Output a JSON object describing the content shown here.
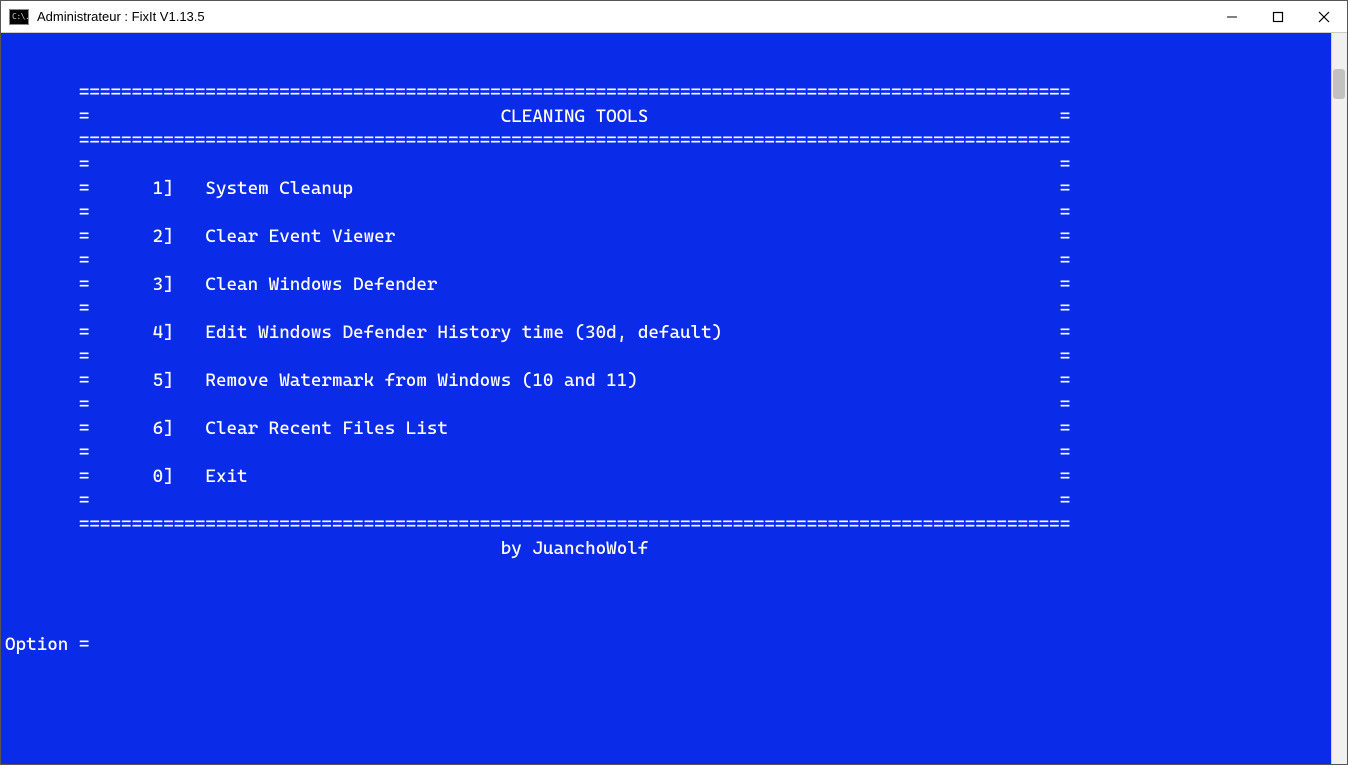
{
  "window": {
    "title": "Administrateur :  FixIt V1.13.5",
    "icon_text": "C:\\."
  },
  "console": {
    "hr": "==============================================================================================",
    "title": "CLEANING TOOLS",
    "menu": [
      {
        "key": "1]",
        "label": "System Cleanup"
      },
      {
        "key": "2]",
        "label": "Clear Event Viewer"
      },
      {
        "key": "3]",
        "label": "Clean Windows Defender"
      },
      {
        "key": "4]",
        "label": "Edit Windows Defender History time (30d, default)"
      },
      {
        "key": "5]",
        "label": "Remove Watermark from Windows (10 and 11)"
      },
      {
        "key": "6]",
        "label": "Clear Recent Files List"
      },
      {
        "key": "0]",
        "label": "Exit"
      }
    ],
    "byline": "by JuanchoWolf",
    "prompt": "Option ="
  }
}
